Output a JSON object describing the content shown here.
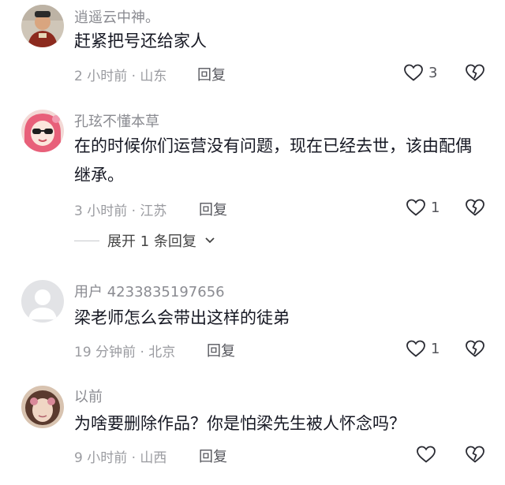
{
  "comments": [
    {
      "username": "逍遥云中神。",
      "content": "赶紧把号还给家人",
      "meta": "2 小时前 · 山东",
      "reply": "回复",
      "likes": "3"
    },
    {
      "username": "孔玹不懂本草",
      "content": "在的时候你们运营没有问题，现在已经去世，该由配偶继承。",
      "meta": "3 小时前 · 江苏",
      "reply": "回复",
      "likes": "1"
    },
    {
      "username": "用户 4233835197656",
      "content": "梁老师怎么会带出这样的徒弟",
      "meta": "19 分钟前 · 北京",
      "reply": "回复",
      "likes": "1"
    },
    {
      "username": "以前",
      "content": "为啥要删除作品？你是怕梁先生被人怀念吗？",
      "meta": "9 小时前 · 山西",
      "reply": "回复",
      "likes": ""
    }
  ],
  "expand_replies": "展开 1 条回复",
  "icons": {
    "like": "heart-outline-icon",
    "dislike": "broken-heart-icon",
    "expand": "chevron-down-icon"
  },
  "colors": {
    "text": "#161823",
    "muted": "#9a9ba0",
    "username": "#8a8b91"
  }
}
